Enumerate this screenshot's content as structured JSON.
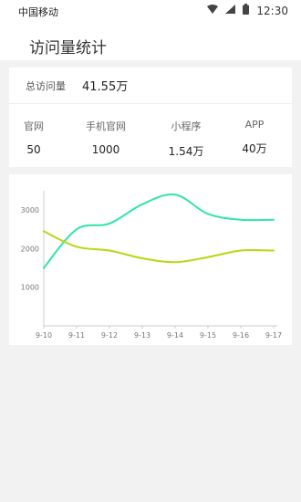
{
  "status_bar": {
    "carrier": "中国移动",
    "time": "12:30",
    "icons": [
      "wifi-icon",
      "signal-icon",
      "battery-icon"
    ]
  },
  "header": {
    "title": "访问量统计"
  },
  "total": {
    "label": "总访问量",
    "value": "41.55万"
  },
  "stats": [
    {
      "label": "官网",
      "value": "50"
    },
    {
      "label": "手机官网",
      "value": "1000"
    },
    {
      "label": "小程序",
      "value": "1.54万"
    },
    {
      "label": "APP",
      "value": "40万"
    }
  ],
  "chart_data": {
    "type": "line",
    "categories": [
      "9-10",
      "9-11",
      "9-12",
      "9-13",
      "9-14",
      "9-15",
      "9-16",
      "9-17"
    ],
    "ylim": [
      0,
      3500
    ],
    "yticks": [
      1000,
      2000,
      3000
    ],
    "colors": [
      "#2ee6a8",
      "#b5d90f"
    ],
    "series": [
      {
        "values": [
          1500,
          2500,
          2650,
          3150,
          3400,
          2900,
          2750,
          2750
        ]
      },
      {
        "values": [
          2450,
          2050,
          1950,
          1750,
          1650,
          1780,
          1950,
          1950
        ]
      }
    ],
    "title": "",
    "xlabel": "",
    "ylabel": "",
    "grid": false
  }
}
